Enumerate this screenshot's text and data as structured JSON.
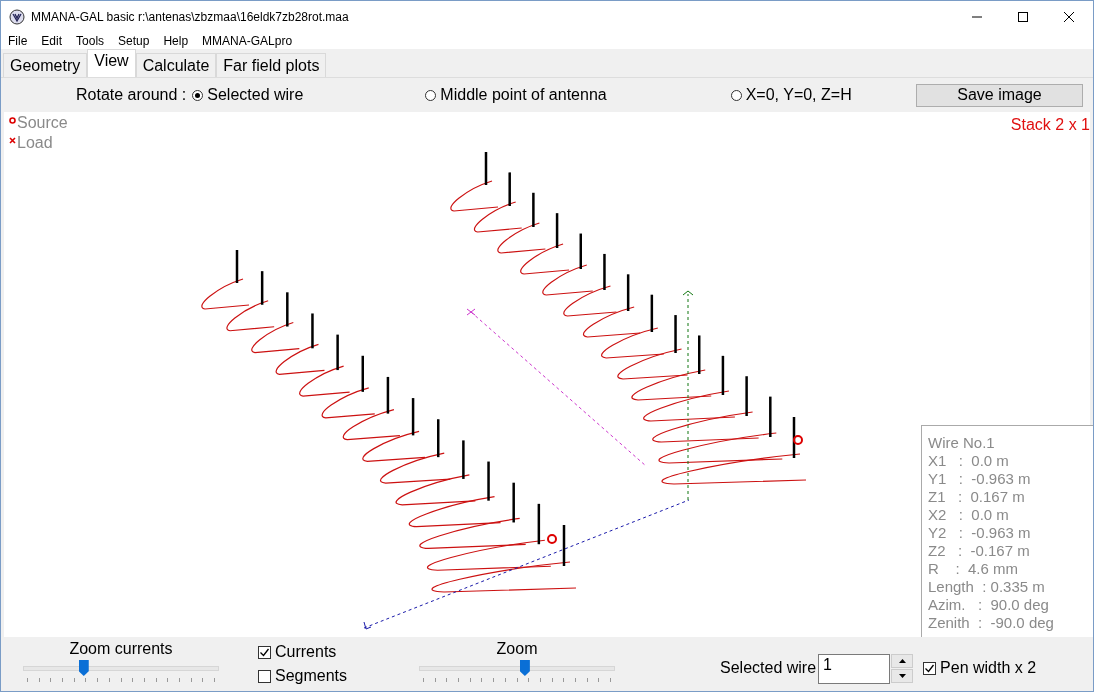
{
  "window": {
    "title": "MMANA-GAL basic r:\\antenas\\zbzmaa\\16eldk7zb28rot.maa"
  },
  "menu": [
    "File",
    "Edit",
    "Tools",
    "Setup",
    "Help",
    "MMANA-GALpro"
  ],
  "tabs": [
    {
      "label": "Geometry",
      "selected": false
    },
    {
      "label": "View",
      "selected": true
    },
    {
      "label": "Calculate",
      "selected": false
    },
    {
      "label": "Far field plots",
      "selected": false
    }
  ],
  "rotate": {
    "label": "Rotate around :",
    "options": [
      {
        "label": "Selected wire",
        "selected": true
      },
      {
        "label": "Middle point of antenna",
        "selected": false
      },
      {
        "label": "X=0, Y=0, Z=H",
        "selected": false
      }
    ]
  },
  "save_button": "Save image",
  "legend": [
    {
      "kind": "source",
      "label": "Source"
    },
    {
      "kind": "load",
      "label": "Load"
    }
  ],
  "stack_label": "Stack 2 x 1",
  "wire_info": [
    "Wire No.1",
    "X1   :  0.0 m",
    "Y1   :  -0.963 m",
    "Z1   :  0.167 m",
    "X2   :  0.0 m",
    "Y2   :  -0.963 m",
    "Z2   :  -0.167 m",
    "R    :  4.6 mm",
    "Length  : 0.335 m",
    "Azim.   :  90.0 deg",
    "Zenith  :  -90.0 deg"
  ],
  "zoom_currents": {
    "label": "Zoom currents",
    "level": 0.31
  },
  "checkboxes": [
    {
      "label": "Currents",
      "checked": true
    },
    {
      "label": "Segments",
      "checked": false
    }
  ],
  "zoom": {
    "label": "Zoom",
    "level": 0.54
  },
  "selected_wire": {
    "label": "Selected wire",
    "value": "1"
  },
  "pen_width": {
    "label": "Pen width x 2",
    "checked": true
  }
}
